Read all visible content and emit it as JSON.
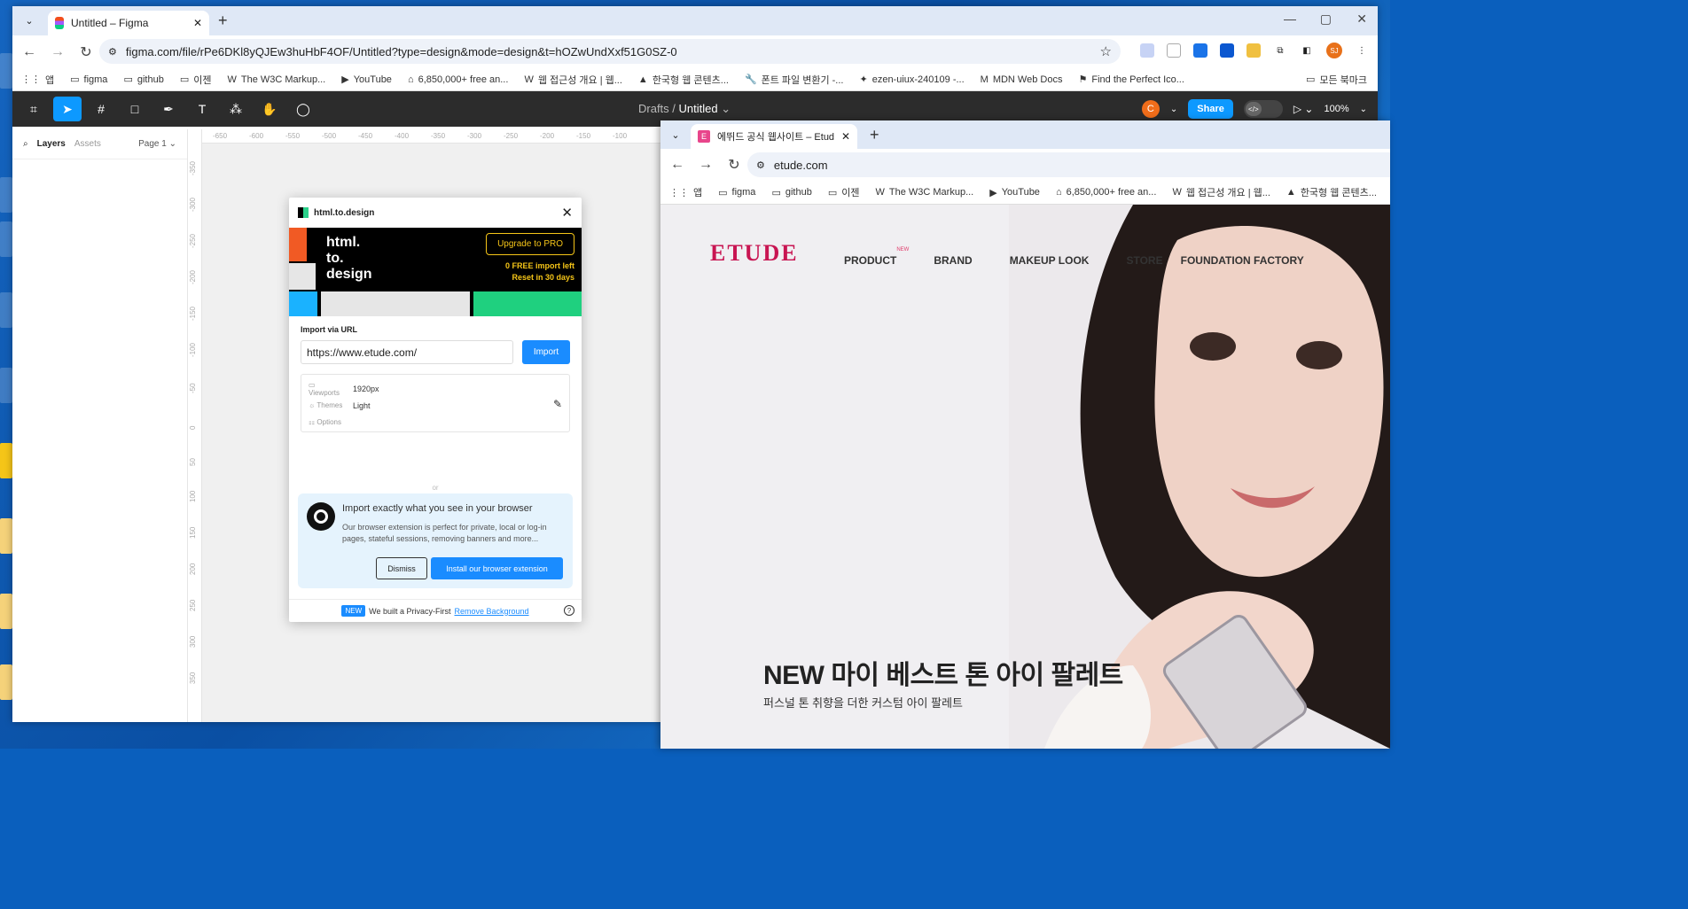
{
  "figma_window": {
    "tab_title": "Untitled – Figma",
    "url": "figma.com/file/rPe6DKl8yQJEw3huHbF4OF/Untitled?type=design&mode=design&t=hOZwUndXxf51G0SZ-0",
    "bookmarks": [
      "앱",
      "figma",
      "github",
      "이젠",
      "The W3C Markup...",
      "YouTube",
      "6,850,000+ free an...",
      "웹 접근성 개요 | 웹...",
      "한국형 웹 콘텐츠...",
      "폰트 파일 변환기 -...",
      "ezen-uiux-240109 -...",
      "MDN Web Docs",
      "Find the Perfect Ico..."
    ],
    "bookmarks_right": "모든 북마크",
    "profile_initials": "SJ",
    "figma": {
      "breadcrumb_drafts": "Drafts",
      "breadcrumb_sep": "/",
      "file_name": "Untitled",
      "user_initial": "C",
      "share_label": "Share",
      "zoom": "100%",
      "layers_tab": "Layers",
      "assets_tab": "Assets",
      "page_label": "Page 1",
      "ruler_top": [
        "-650",
        "-600",
        "-550",
        "-500",
        "-450",
        "-400",
        "-350",
        "-300",
        "-250",
        "-200",
        "-150",
        "-100"
      ],
      "ruler_left": [
        "-350",
        "-300",
        "-250",
        "-200",
        "-150",
        "-100",
        "-50",
        "0",
        "50",
        "100",
        "150",
        "200",
        "250",
        "300",
        "350"
      ]
    },
    "plugin": {
      "title": "html.to.design",
      "brand_lines": [
        "html.",
        "to.",
        "design"
      ],
      "upgrade_label": "Upgrade to PRO",
      "free_import": "0 FREE import left",
      "reset": "Reset in 30 days",
      "import_via_url": "Import via URL",
      "url_value": "https://www.etude.com/",
      "import_label": "Import",
      "viewports_key": "Viewports",
      "viewports_value": "1920px",
      "themes_key": "Themes",
      "themes_value": "Light",
      "options_key": "Options",
      "or_label": "or",
      "ext_title": "Import exactly what you see in your browser",
      "ext_desc": "Our browser extension is perfect for private, local or log-in pages, stateful sessions, removing banners and more...",
      "dismiss_label": "Dismiss",
      "install_label": "Install our browser extension",
      "foot_badge": "NEW",
      "foot_text": "We built a Privacy-First",
      "foot_link": "Remove Background",
      "help": "?"
    }
  },
  "etude_window": {
    "tab_title": "에뛰드 공식 웹사이트 – Etude",
    "url": "etude.com",
    "bookmarks": [
      "앱",
      "figma",
      "github",
      "이젠",
      "The W3C Markup...",
      "YouTube",
      "6,850,000+ free an...",
      "웹 접근성 개요 | 웹...",
      "한국형 웹 콘텐츠..."
    ],
    "site": {
      "logo": "ETUDE",
      "nav": [
        "PRODUCT",
        "BRAND",
        "MAKEUP LOOK",
        "STORE",
        "FOUNDATION FACTORY"
      ],
      "nav_new_badge": "NEW",
      "hero_title": "NEW 마이 베스트 톤 아이 팔레트",
      "hero_sub": "퍼스널 톤 취향을 더한 커스텀 아이 팔레트"
    }
  },
  "colors": {
    "figma_blue": "#0d99ff",
    "etude_pink": "#c81552",
    "plugin_yellow": "#f5c518"
  }
}
